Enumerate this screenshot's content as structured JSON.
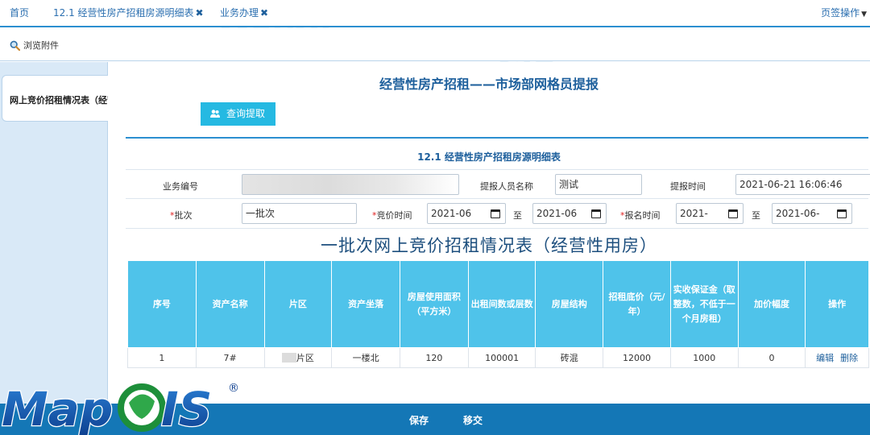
{
  "colors": {
    "accent": "#2b8fd0",
    "header_cell": "#4fc3ea",
    "bottom_bar": "#1477b6",
    "title": "#1d5f9c",
    "required": "#e02020"
  },
  "tabs": [
    {
      "label": "首页",
      "closable": false
    },
    {
      "label": "12.1 经营性房产招租房源明细表",
      "closable": true
    },
    {
      "label": "业务办理",
      "closable": true
    }
  ],
  "tab_close_icon": "close-icon",
  "tab_ops_label": "页签操作",
  "toolbar": {
    "browse_label": "浏览附件",
    "browse_icon": "search-icon"
  },
  "left_panel": {
    "item_label": "网上竞价招租情况表（经营"
  },
  "main": {
    "title": "经营性房产招租——市场部网格员提报",
    "query_button": "查询提取",
    "section_title": "12.1 经营性房产招租房源明细表"
  },
  "form": {
    "business_no_label": "业务编号",
    "business_no_value": "",
    "reporter_label": "提报人员名称",
    "reporter_value": "测试",
    "report_time_label": "提报时间",
    "report_time_value": "2021-06-21 16:06:46",
    "batch_label": "批次",
    "batch_value": "一批次",
    "bid_time_label": "竞价时间",
    "bid_time_from": "2021-06",
    "bid_time_to": "2021-06",
    "signup_time_label": "报名时间",
    "signup_time_from": "2021-",
    "signup_time_to": "2021-06-",
    "to_label": "至",
    "required_mark": "*"
  },
  "table": {
    "title": "一批次网上竞价招租情况表（经营性用房）",
    "headers": [
      "序号",
      "资产名称",
      "片区",
      "资产坐落",
      "房屋使用面积（平方米）",
      "出租间数或层数",
      "房屋结构",
      "招租底价（元/年）",
      "实收保证金（取整数，不低于一个月房租）",
      "加价幅度",
      "操作"
    ],
    "rows": [
      {
        "no": "1",
        "asset_name": "7#",
        "area_suffix": "片区",
        "location": "一楼北",
        "usable_area": "120",
        "rooms": "100001",
        "structure": "砖混",
        "base_price": "12000",
        "deposit": "1000",
        "increment": "0",
        "edit": "编辑",
        "delete": "删除"
      }
    ]
  },
  "bottom_bar": {
    "save_label": "保存",
    "transfer_label": "移交"
  },
  "branding": {
    "logo_text": "MapGIS",
    "registered": "®"
  }
}
